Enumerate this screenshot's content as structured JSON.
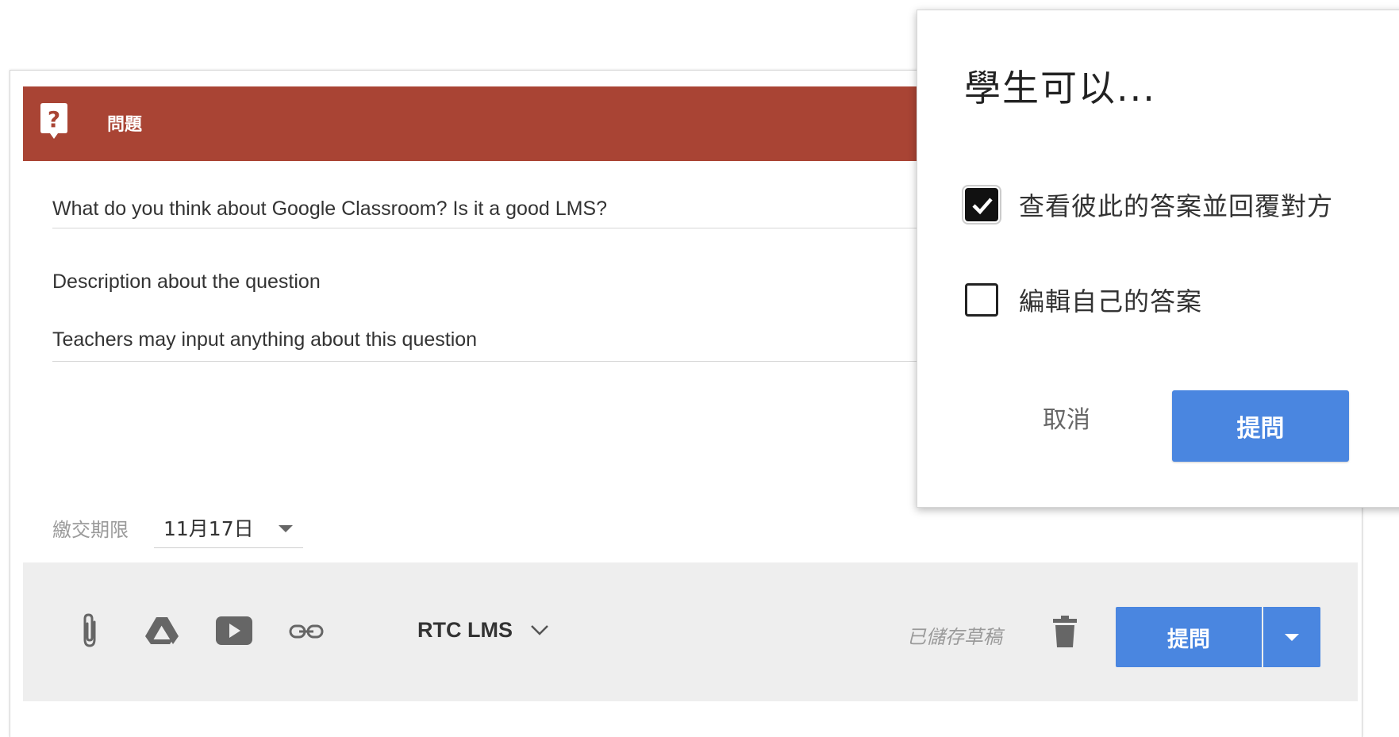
{
  "header": {
    "title": "問題",
    "icon": "question-bubble-icon",
    "color": "#a94434"
  },
  "form": {
    "question": "What do you think about Google Classroom? Is it a good LMS?",
    "description_label": "Description about the question",
    "description_value": "Teachers may input anything about this question",
    "due_label": "繳交期限",
    "due_value": "11月17日"
  },
  "footer": {
    "icons": [
      "paperclip-icon",
      "google-drive-icon",
      "youtube-icon",
      "link-icon"
    ],
    "class_name": "RTC LMS",
    "saved_status": "已儲存草稿",
    "ask_label": "提問",
    "accent": "#4a86e0"
  },
  "popup": {
    "title": "學生可以...",
    "options": [
      {
        "label": "查看彼此的答案並回覆對方",
        "checked": true
      },
      {
        "label": "編輯自己的答案",
        "checked": false
      }
    ],
    "cancel_label": "取消",
    "ask_label": "提問"
  }
}
